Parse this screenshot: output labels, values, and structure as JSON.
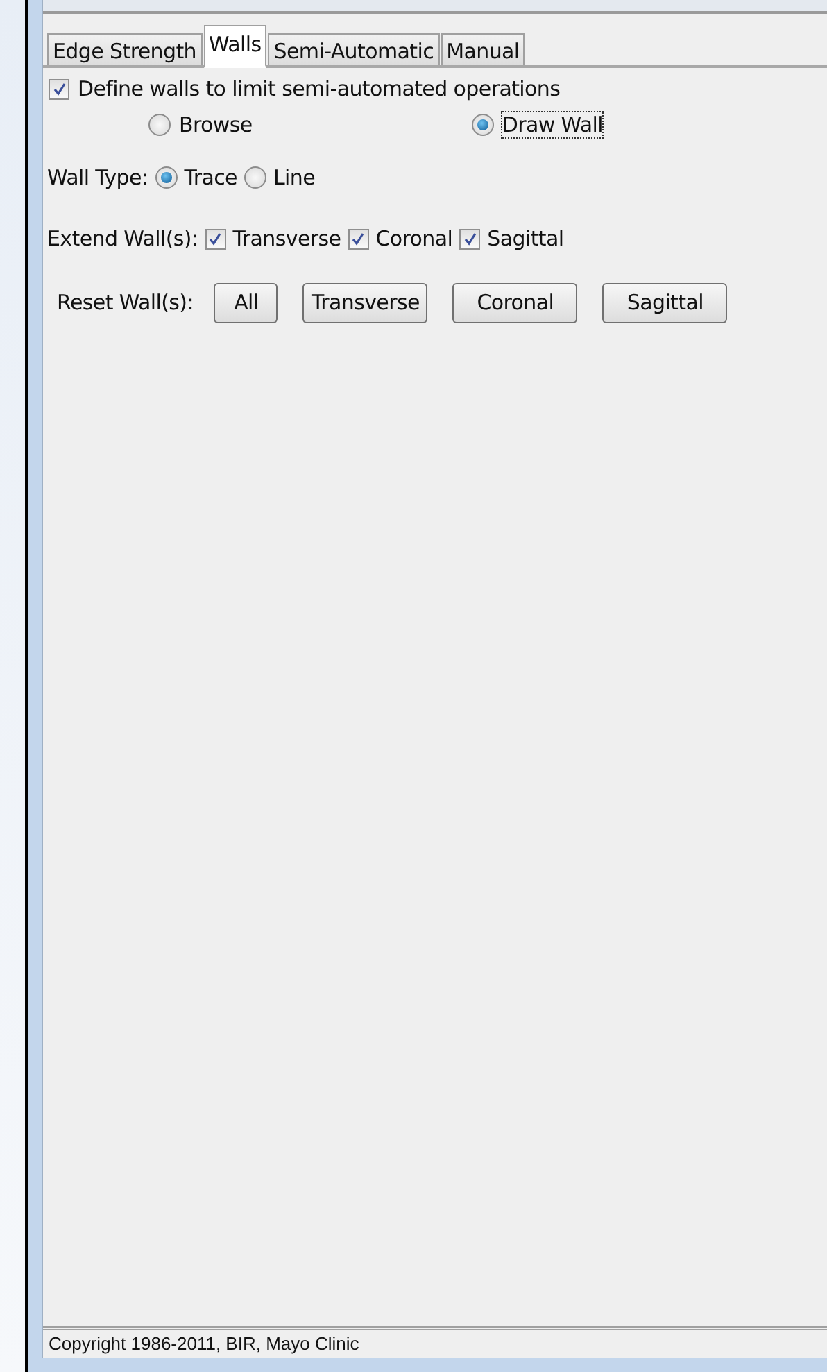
{
  "tabs": [
    {
      "label": "Edge Strength",
      "selected": false
    },
    {
      "label": "Walls",
      "selected": true
    },
    {
      "label": "Semi-Automatic",
      "selected": false
    },
    {
      "label": "Manual",
      "selected": false
    }
  ],
  "define_walls": {
    "label": "Define walls to limit semi-automated operations",
    "checked": true
  },
  "mode": [
    {
      "label": "Browse",
      "selected": false
    },
    {
      "label": "Draw Wall",
      "selected": true,
      "focused": true
    }
  ],
  "wall_type": {
    "label": "Wall Type:",
    "options": [
      {
        "label": "Trace",
        "selected": true
      },
      {
        "label": "Line",
        "selected": false
      }
    ]
  },
  "extend_walls": {
    "label": "Extend Wall(s):",
    "options": [
      {
        "label": "Transverse",
        "checked": true
      },
      {
        "label": "Coronal",
        "checked": true
      },
      {
        "label": "Sagittal",
        "checked": true
      }
    ]
  },
  "reset_walls": {
    "label": "Reset Wall(s):",
    "buttons": [
      "All",
      "Transverse",
      "Coronal",
      "Sagittal"
    ]
  },
  "status_bar": "Copyright 1986-2011, BIR, Mayo Clinic"
}
